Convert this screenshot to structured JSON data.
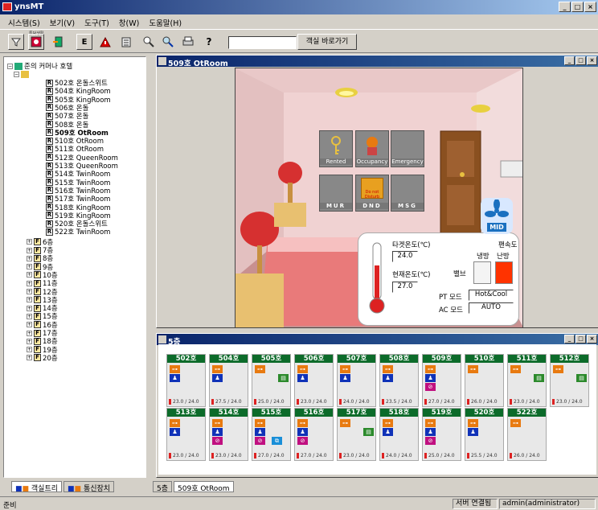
{
  "app": {
    "title": "ynsMT"
  },
  "menu": [
    "시스템(S)",
    "보기(V)",
    "도구(T)",
    "창(W)",
    "도움말(H)"
  ],
  "toolbar": {
    "small_label": "투덕생활",
    "search_value": "",
    "go_label": "객실 바로가기"
  },
  "tree": {
    "root": "준의 커머나 호텔",
    "rooms": [
      {
        "label": "502호 온돌스위트",
        "bold": false
      },
      {
        "label": "504호 KingRoom",
        "bold": false
      },
      {
        "label": "505호 KingRoom",
        "bold": false
      },
      {
        "label": "506호 온돌",
        "bold": false
      },
      {
        "label": "507호 온돌",
        "bold": false
      },
      {
        "label": "508호 온돌",
        "bold": false
      },
      {
        "label": "509호 OtRoom",
        "bold": true
      },
      {
        "label": "510호 OtRoom",
        "bold": false
      },
      {
        "label": "511호 OtRoom",
        "bold": false
      },
      {
        "label": "512호 QueenRoom",
        "bold": false
      },
      {
        "label": "513호 QueenRoom",
        "bold": false
      },
      {
        "label": "514호 TwinRoom",
        "bold": false
      },
      {
        "label": "515호 TwinRoom",
        "bold": false
      },
      {
        "label": "516호 TwinRoom",
        "bold": false
      },
      {
        "label": "517호 TwinRoom",
        "bold": false
      },
      {
        "label": "518호 KingRoom",
        "bold": false
      },
      {
        "label": "519호 KingRoom",
        "bold": false
      },
      {
        "label": "520호 온돌스위트",
        "bold": false
      },
      {
        "label": "522호 TwinRoom",
        "bold": false
      }
    ],
    "floors": [
      "6층",
      "7층",
      "8층",
      "9층",
      "10층",
      "11층",
      "12층",
      "13층",
      "14층",
      "15층",
      "16층",
      "17층",
      "18층",
      "19층",
      "20층"
    ]
  },
  "left_tabs": [
    "객실트리",
    "통신장치"
  ],
  "room_window": {
    "title": "509호 OtRoom",
    "panels": [
      "Rented",
      "Occupancy",
      "Emergency",
      "MUR",
      "DND",
      "MSG"
    ],
    "dnd_text": "Do not Disturb",
    "fan_level": "MID",
    "target_temp_label": "타겟온도(℃)",
    "target_temp": "24.0",
    "current_temp_label": "현재온도(℃)",
    "current_temp": "27.0",
    "fan_speed_label": "팬속도",
    "cool_label": "냉방",
    "heat_label": "난방",
    "valve_label": "밸브",
    "pt_mode_label": "PT 모드",
    "pt_mode": "Hot&Cool",
    "ac_mode_label": "AC 모드",
    "ac_mode": "AUTO"
  },
  "floor_window": {
    "title": "5층",
    "cards": [
      {
        "room": "502호",
        "icons": [
          "key",
          "occ"
        ],
        "temp": "23.0 / 24.0"
      },
      {
        "room": "504호",
        "icons": [
          "key",
          "occ"
        ],
        "temp": "27.5 / 24.0"
      },
      {
        "room": "505호",
        "icons": [
          "key",
          "msg"
        ],
        "temp": "25.0 / 24.0"
      },
      {
        "room": "506호",
        "icons": [
          "key",
          "occ"
        ],
        "temp": "23.0 / 24.0"
      },
      {
        "room": "507호",
        "icons": [
          "key",
          "occ"
        ],
        "temp": "24.0 / 24.0"
      },
      {
        "room": "508호",
        "icons": [
          "key",
          "occ"
        ],
        "temp": "23.5 / 24.0"
      },
      {
        "room": "509호",
        "icons": [
          "key",
          "occ",
          "dnd"
        ],
        "temp": "27.0 / 24.0"
      },
      {
        "room": "510호",
        "icons": [
          "key"
        ],
        "temp": "26.0 / 24.0"
      },
      {
        "room": "511호",
        "icons": [
          "key",
          "msg"
        ],
        "temp": "23.0 / 24.0"
      },
      {
        "room": "512호",
        "icons": [
          "key",
          "msg"
        ],
        "temp": "23.0 / 24.0"
      },
      {
        "room": "513호",
        "icons": [
          "key",
          "occ"
        ],
        "temp": "23.0 / 24.0"
      },
      {
        "room": "514호",
        "icons": [
          "key",
          "occ",
          "dnd"
        ],
        "temp": "23.0 / 24.0"
      },
      {
        "room": "515호",
        "icons": [
          "key",
          "occ",
          "dnd",
          "mur"
        ],
        "temp": "27.0 / 24.0"
      },
      {
        "room": "516호",
        "icons": [
          "key",
          "occ",
          "dnd"
        ],
        "temp": "27.0 / 24.0"
      },
      {
        "room": "517호",
        "icons": [
          "key",
          "msg"
        ],
        "temp": "23.0 / 24.0"
      },
      {
        "room": "518호",
        "icons": [
          "key",
          "occ"
        ],
        "temp": "24.0 / 24.0"
      },
      {
        "room": "519호",
        "icons": [
          "key",
          "occ",
          "dnd"
        ],
        "temp": "25.0 / 24.0"
      },
      {
        "room": "520호",
        "icons": [
          "key",
          "occ"
        ],
        "temp": "25.5 / 24.0"
      },
      {
        "room": "522호",
        "icons": [
          "key"
        ],
        "temp": "26.0 / 24.0"
      }
    ]
  },
  "mdi_tabs": [
    "5층",
    "509호 OtRoom"
  ],
  "status": {
    "left": "준비",
    "conn": "서버 연결됨",
    "user": "admin(administrator)"
  },
  "colors": {
    "title_bar": "#0a246a",
    "card_header": "#0c6b2a",
    "key": "#e87a10",
    "occupancy": "#1032b8",
    "dnd": "#c01080",
    "heat": "#ff3300"
  }
}
